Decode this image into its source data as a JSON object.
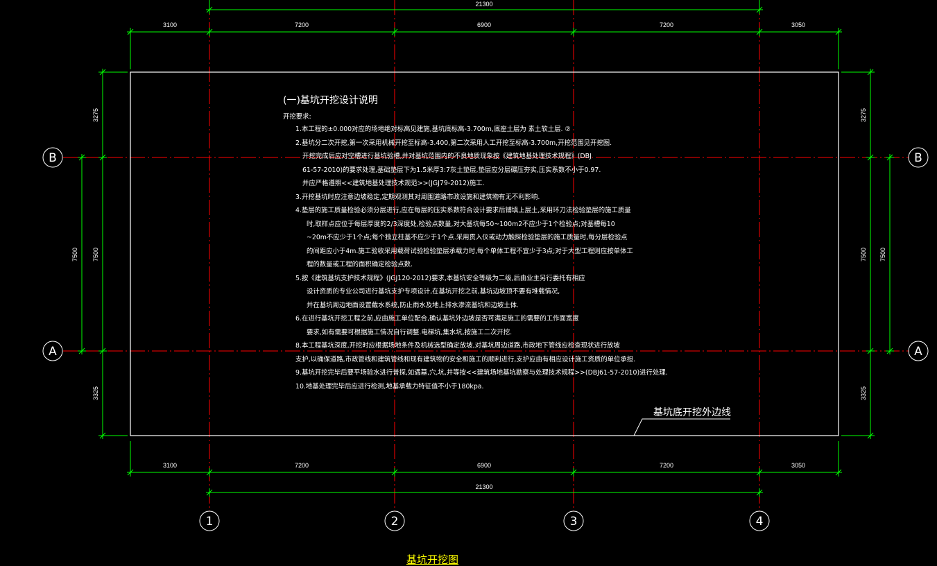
{
  "drawing": {
    "title": "基坑开挖图",
    "callout": "基坑底开挖外边线",
    "notes_title": "(一)基坑开挖设计说明",
    "notes_heading": "开挖要求:",
    "notes": [
      "1.本工程的±0.000对应的场地绝对标高见建施,基坑底标高-3.700m,底座土层为    素土软土层.        ②",
      "2.基坑分二次开挖,第一次采用机械开挖至标高-3.400,第二次采用人工开挖至标高-3.700m,开挖范围见开挖图.",
      "开挖完成后应对空槽进行基坑验槽,并对基坑范围内的不良地质现象按《建筑地基处理技术规程》(DBJ",
      "61-57-2010)的要求处理,基础垫层下为1.5米厚3:7灰土垫层,垫层应分层碾压夯实,压实系数不小于0.97.",
      "并应严格遵照<<建筑地基处理技术规范>>(JGJ79-2012)施工.",
      "3.开挖基坑时应注意边坡稳定,定期观测其对周围道路市政设施和建筑物有无不利影响.",
      "4.垫层的施工质量检验必须分层进行,应在每层的压实系数符合设计要求后铺填上层土,采用环刀法检验垫层的施工质量",
      "时,取样点应位于每层厚度的2/3深度处,检验点数量,对大基坑每50~100m2不应少于1个检验点;对基槽每10",
      "~20m不应少于1个点;每个独立柱基不应少于1个点.采用贯入仪或动力触探检验垫层的施工质量时,每分层检验点",
      "的间距应小于4m.施工验收采用载荷试验检验垫层承载力时,每个单体工程不宜少于3点;对于大型工程则应按单体工",
      "程的数量或工程的面积确定检验点数.",
      "5.按《建筑基坑支护技术规程》(JGJ120-2012)要求,本基坑安全等级为二级,后由业主另行委托有相应",
      "设计资质的专业公司进行基坑支护专项设计,在基坑开挖之前,基坑边坡顶不要有堆载情况,",
      "并在基坑周边地面设置截水系统,防止雨水及地上排水渗流基坑和边坡土体.",
      "6.在进行基坑开挖工程之前,应由施工单位配合,确认基坑外边坡是否可满足施工的需要的工作面宽度",
      "要求,如有需要可根据施工情况自行调整.电梯坑,集水坑,按施工二次开挖.",
      "8.本工程基坑深度,开挖时应根据场地条件及机械选型确定放坡,对基坑周边道路,市政地下管线应检查现状进行放坡",
      "支护,以确保道路,市政管线和建筑管线和现有建筑物的安全和施工的顺利进行,支护应由有相应设计施工资质的单位承担.",
      "9.基坑开挖完毕后要平场验水进行普探,如遇墓,穴,坑,井等按<<建筑场地基坑勘察与处理技术规程>>(DBJ61-57-2010)进行处理.",
      "10.地基处理完毕后应进行检测,地基承载力特征值不小于180kpa."
    ],
    "grid_axes": {
      "columns": [
        "1",
        "2",
        "3",
        "4"
      ],
      "rows": [
        "B",
        "A"
      ]
    },
    "dimensions": {
      "top_overall": "21300",
      "top_segments": [
        "3100",
        "7200",
        "6900",
        "7200",
        "3050"
      ],
      "bottom_segments": [
        "3100",
        "7200",
        "6900",
        "7200",
        "3050"
      ],
      "bottom_overall": "21300",
      "left_segments": [
        "3275",
        "7500",
        "3325"
      ],
      "left_inner": "7500",
      "right_segments": [
        "3275",
        "7500",
        "3325"
      ],
      "right_inner": "7500"
    },
    "colors": {
      "background": "#000000",
      "dimension_line": "#00ff00",
      "axis_line": "#ff0000",
      "outline": "#ffffff",
      "title": "#ffff00"
    }
  }
}
